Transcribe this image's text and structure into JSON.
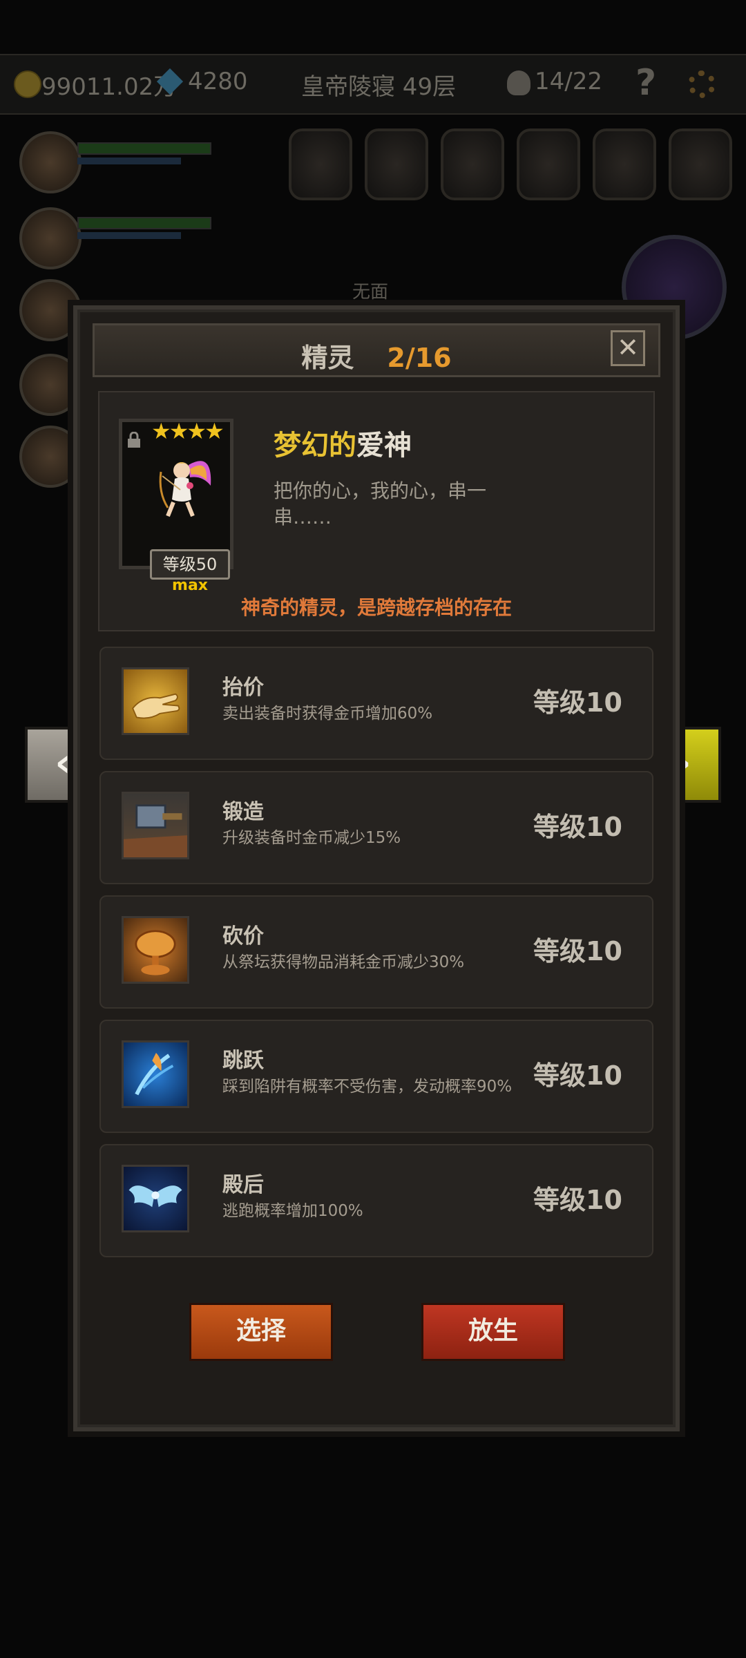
{
  "topbar": {
    "gold": "99011.02万",
    "gems": "4280",
    "location": "皇帝陵寝 49层",
    "kills": "14/22",
    "help": "?"
  },
  "background": {
    "empty_label": "无面"
  },
  "modal": {
    "title": "精灵",
    "count": "2/16",
    "close": "✕",
    "sprite": {
      "stars": "★★★★",
      "name_highlight": "梦幻的",
      "name_plain": "爱神",
      "description": "把你的心，我的心，串一串……",
      "level_label": "等级50",
      "max_label": "max",
      "note": "神奇的精灵，是跨越存档的存在"
    },
    "skills": [
      {
        "name": "抬价",
        "desc": "卖出装备时获得金币增加60%",
        "level": "等级10",
        "icon": "hand-icon"
      },
      {
        "name": "锻造",
        "desc": "升级装备时金币减少15%",
        "level": "等级10",
        "icon": "hammer-icon"
      },
      {
        "name": "砍价",
        "desc": "从祭坛获得物品消耗金币减少30%",
        "level": "等级10",
        "icon": "coin-stack-icon"
      },
      {
        "name": "跳跃",
        "desc": "踩到陷阱有概率不受伤害，发动概率90%",
        "level": "等级10",
        "icon": "jump-icon"
      },
      {
        "name": "殿后",
        "desc": "逃跑概率增加100%",
        "level": "等级10",
        "icon": "wings-icon"
      }
    ],
    "buttons": {
      "select": "选择",
      "release": "放生"
    }
  },
  "nav": {
    "prev": "‹",
    "next": "›"
  },
  "colors": {
    "accent_orange": "#e69a2e",
    "name_gold": "#e8c233",
    "note_orange": "#e17a3a",
    "next_arrow": "#d4cf1c"
  }
}
